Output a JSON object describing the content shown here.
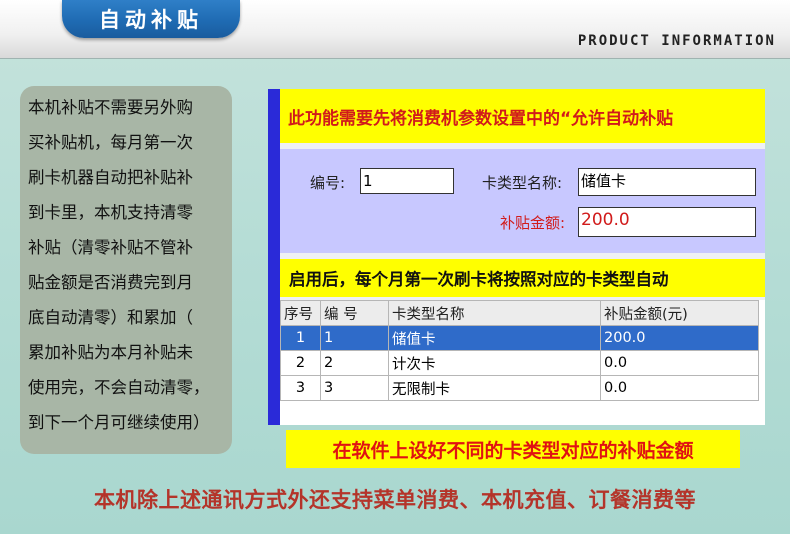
{
  "header": {
    "title": "自动补贴",
    "subtitle": "PRODUCT INFORMATION"
  },
  "description_lines": [
    "本机补贴不需要另外购",
    "买补贴机，每月第一次",
    "刷卡机器自动把补贴补",
    "到卡里，本机支持清零",
    "补贴（清零补贴不管补",
    "贴金额是否消费完到月",
    "底自动清零）和累加（",
    "累加补贴为本月补贴未",
    "使用完，不会自动清零，",
    "到下一个月可继续使用）"
  ],
  "app": {
    "notice_top": "此功能需要先将消费机参数设置中的“允许自动补贴",
    "form": {
      "id_label": "编号:",
      "id_value": "1",
      "card_type_label": "卡类型名称:",
      "card_type_value": "储值卡",
      "amount_label": "补贴金额:",
      "amount_value": "200.0"
    },
    "notice_mid": "启用后，每个月第一次刷卡将按照对应的卡类型自动",
    "table": {
      "headers": [
        "序号",
        "编 号",
        "卡类型名称",
        "补贴金额(元)"
      ],
      "rows": [
        [
          "1",
          "1",
          "储值卡",
          "200.0"
        ],
        [
          "2",
          "2",
          "计次卡",
          "0.0"
        ],
        [
          "3",
          "3",
          "无限制卡",
          "0.0"
        ]
      ],
      "selected_row": 0
    }
  },
  "caption": "在软件上设好不同的卡类型对应的补贴金额",
  "footer": "本机除上述通讯方式外还支持菜单消费、本机充值、订餐消费等",
  "colors": {
    "title_tab": "#1f6bb3",
    "notice_bg": "#ffff00",
    "notice_text": "#d11b1b",
    "form_bg": "#c8c8ff",
    "selected_row": "#2f6bc9",
    "footer_text": "#b4342a"
  }
}
